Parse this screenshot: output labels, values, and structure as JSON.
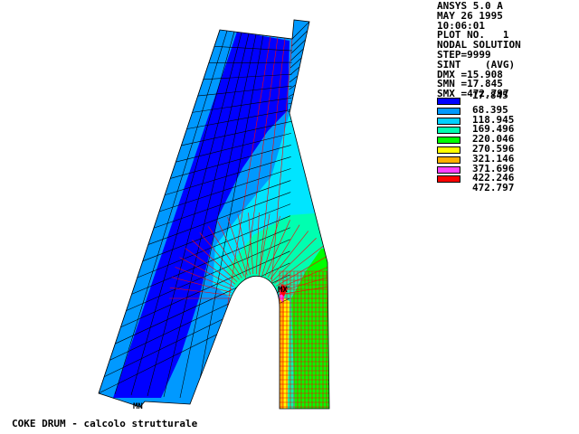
{
  "header": {
    "lines": [
      "ANSYS 5.0 A",
      "MAY 26 1995",
      "10:06:01",
      "PLOT NO.   1",
      "NODAL SOLUTION",
      "STEP=9999",
      "SINT    (AVG)",
      "DMX =15.908",
      "SMN =17.845",
      "SMX =472.797"
    ]
  },
  "legend": {
    "values": [
      "17.845",
      "68.395",
      "118.945",
      "169.496",
      "220.046",
      "270.596",
      "321.146",
      "371.696",
      "422.246",
      "472.797"
    ],
    "colors": [
      "#0000ff",
      "#0099ff",
      "#00d0ff",
      "#00ffb0",
      "#00ff00",
      "#ffff00",
      "#ffb000",
      "#ff40ff",
      "#ff0000"
    ]
  },
  "plot": {
    "markers": [
      "MX",
      "MN"
    ],
    "colors": {
      "band1": "#0000ff",
      "band2": "#0099ff",
      "band3": "#00e5ff",
      "band4": "#00ffb0",
      "band5": "#00ff00",
      "band6": "#ffff00",
      "band7": "#ffb000",
      "band8": "#ff40ff",
      "band9": "#ff0000",
      "mesh": "#ff0000",
      "mesh_dark": "#000000"
    }
  },
  "footer": {
    "caption": "COKE DRUM - calcolo strutturale"
  }
}
